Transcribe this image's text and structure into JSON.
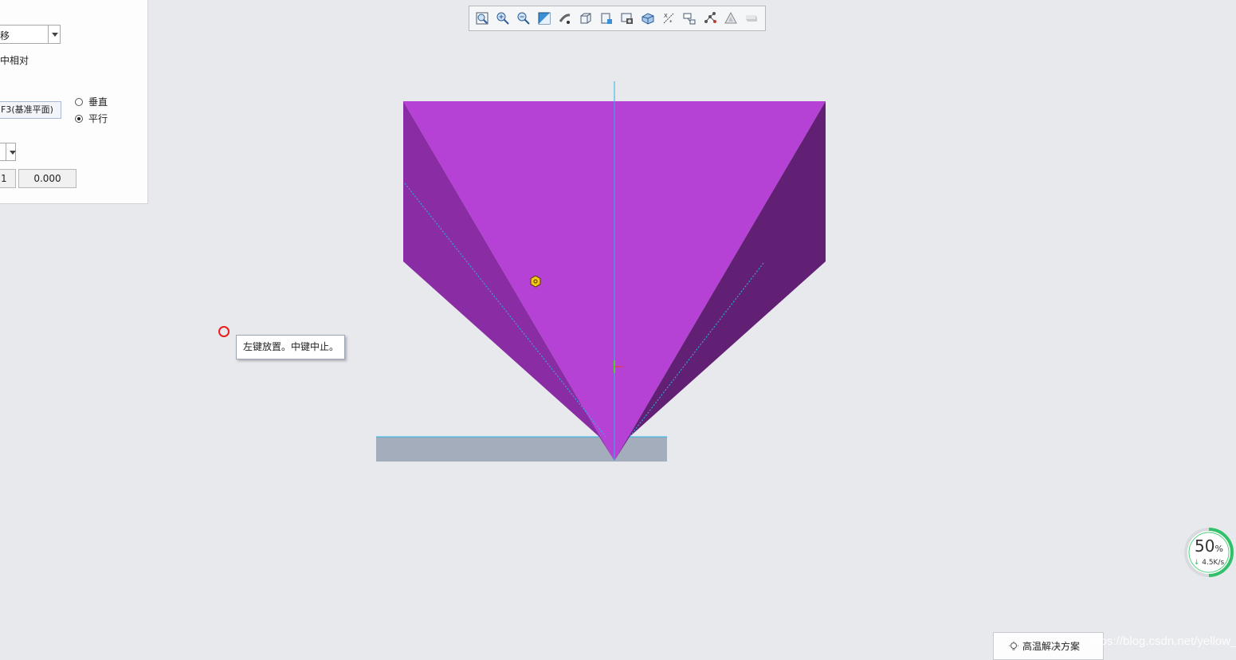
{
  "panel": {
    "type_dropdown_value": "移",
    "relative_label": "中相对",
    "reference_value": "F3(基准平面)",
    "orientation": {
      "options": [
        "垂直",
        "平行"
      ],
      "selected": "平行"
    },
    "offset_left_value": "1",
    "offset_value": "0.000"
  },
  "toolbar": {
    "buttons": [
      "zoom-fit-icon",
      "zoom-in-icon",
      "zoom-out-icon",
      "repaint-icon",
      "spin-center-icon",
      "display-style-icon",
      "saved-orientations-icon",
      "view-manager-icon",
      "perspective-icon",
      "datum-display-icon",
      "annotation-display-icon",
      "spin-toggle-icon",
      "simulation-icon",
      "appearance-icon"
    ]
  },
  "graphics": {
    "tooltip": "左键放置。中键中止。"
  },
  "network_widget": {
    "percent": "50",
    "percent_unit": "%",
    "speed": "4.5K/s"
  },
  "bottom_button": {
    "label": "高温解决方案"
  },
  "watermark": "https://blog.csdn.net/yellow_hill",
  "colors": {
    "part_face": "#b541d5",
    "part_left_side": "#8a2da4",
    "part_right_side": "#622075",
    "base_plate": "#a3adbb",
    "datum_axis": "#27b8e8"
  }
}
